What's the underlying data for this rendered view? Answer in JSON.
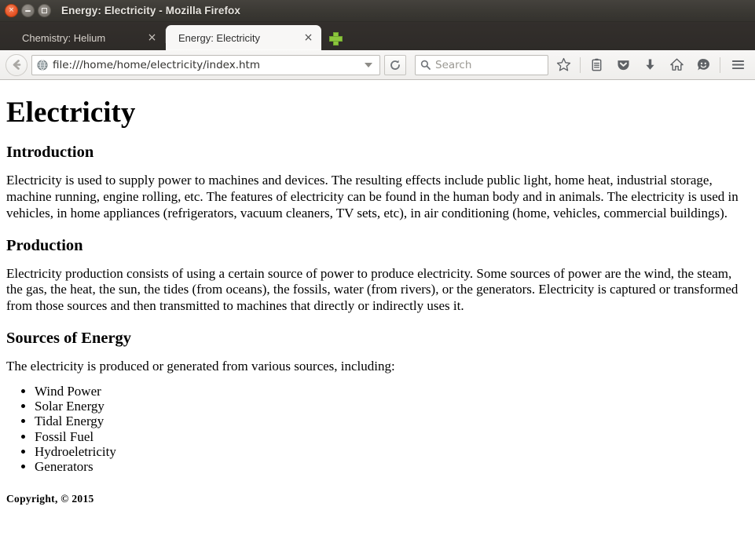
{
  "window": {
    "title": "Energy: Electricity - Mozilla Firefox",
    "controls": {
      "close_label": "×",
      "minimize_name": "minimize-button",
      "maximize_name": "maximize-button"
    }
  },
  "tabs": [
    {
      "label": "Chemistry: Helium",
      "close_label": "×",
      "active": false
    },
    {
      "label": "Energy: Electricity",
      "close_label": "×",
      "active": true
    }
  ],
  "new_tab": {
    "icon": "plus-icon",
    "color": "#8cc63e"
  },
  "navbar": {
    "back_icon": "back-arrow-icon",
    "favicon": "globe-icon",
    "url_value": "file:///home/home/electricity/index.htm",
    "url_dropdown_icon": "chevron-down-icon",
    "reload_icon": "reload-icon",
    "search_placeholder": "Search",
    "search_icon": "search-icon",
    "icons": [
      {
        "name": "bookmark-star-icon",
        "title": "Bookmark this page"
      },
      {
        "name": "reading-list-icon",
        "title": "Show your bookmarks"
      },
      {
        "name": "pocket-shield-icon",
        "title": "Save to Pocket"
      },
      {
        "name": "downloads-arrow-icon",
        "title": "Downloads"
      },
      {
        "name": "home-icon",
        "title": "Home"
      },
      {
        "name": "feedback-smiley-icon",
        "title": "Feedback"
      },
      {
        "name": "hamburger-menu-icon",
        "title": "Open menu"
      }
    ]
  },
  "page": {
    "title": "Electricity",
    "sections": [
      {
        "heading": "Introduction",
        "paragraph": "Electricity is used to supply power to machines and devices. The resulting effects include public light, home heat, industrial storage, machine running, engine rolling, etc. The features of electricity can be found in the human body and in animals. The electricity is used in vehicles, in home appliances (refrigerators, vacuum cleaners, TV sets, etc), in air conditioning (home, vehicles, commercial buildings)."
      },
      {
        "heading": "Production",
        "paragraph": "Electricity production consists of using a certain source of power to produce electricity. Some sources of power are the wind, the steam, the gas, the heat, the sun, the tides (from oceans), the fossils, water (from rivers), or the generators. Electricity is captured or transformed from those sources and then transmitted to machines that directly or indirectly uses it."
      },
      {
        "heading": "Sources of Energy",
        "paragraph": "The electricity is produced or generated from various sources, including:"
      }
    ],
    "sources_list": [
      "Wind Power",
      "Solar Energy",
      "Tidal Energy",
      "Fossil Fuel",
      "Hydroeletricity",
      "Generators"
    ],
    "copyright": "Copyright, © 2015"
  },
  "colors": {
    "titlebar": "#3a3833",
    "tabbar": "#2e2b28",
    "toolbar": "#f2f1ef",
    "active_tab": "#f8f7f6",
    "close_button": "#e8572a",
    "new_tab_green": "#8cc63e",
    "page_background": "#ffffff",
    "page_text": "#000000"
  }
}
